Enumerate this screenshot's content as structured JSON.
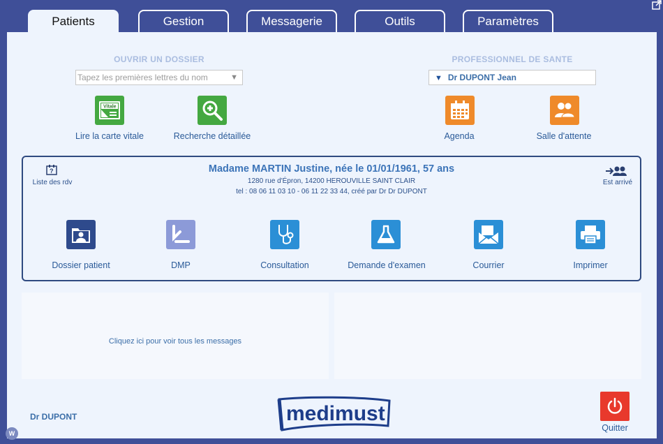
{
  "tabs": [
    {
      "label": "Patients",
      "active": true
    },
    {
      "label": "Gestion"
    },
    {
      "label": "Messagerie"
    },
    {
      "label": "Outils"
    },
    {
      "label": "Paramètres"
    }
  ],
  "open_file": {
    "title": "OUVRIR UN DOSSIER",
    "search_placeholder": "Tapez les premières lettres du nom",
    "actions": [
      {
        "label": "Lire la carte vitale",
        "icon": "vitale-card-icon",
        "badge": "Vitale"
      },
      {
        "label": "Recherche détaillée",
        "icon": "magnify-plus-icon"
      }
    ]
  },
  "professional": {
    "title": "PROFESSIONNEL DE SANTE",
    "selected": "Dr DUPONT Jean",
    "actions": [
      {
        "label": "Agenda",
        "icon": "calendar-icon"
      },
      {
        "label": "Salle d'attente",
        "icon": "waiting-room-icon"
      }
    ]
  },
  "patient": {
    "name": "Madame MARTIN Justine, née le 01/01/1961, 57 ans",
    "address": "1280 rue d'Épron, 14200 HEROUVILLE SAINT CLAIR",
    "tel": "tel : 08 06 11 03 10 - 06 11 22 33 44, créé par Dr Dr DUPONT",
    "rdv_list": "Liste des rdv",
    "arrived": "Est arrivé",
    "actions": [
      {
        "label": "Dossier patient",
        "icon": "patient-folder-icon"
      },
      {
        "label": "DMP",
        "icon": "dmp-icon"
      },
      {
        "label": "Consultation",
        "icon": "stethoscope-icon"
      },
      {
        "label": "Demande d'examen",
        "icon": "flask-icon"
      },
      {
        "label": "Courrier",
        "icon": "envelope-icon"
      },
      {
        "label": "Imprimer",
        "icon": "printer-icon"
      }
    ]
  },
  "messages": {
    "link": "Cliquez ici pour voir tous les messages"
  },
  "footer": {
    "user": "Dr DUPONT",
    "logo": "medimust",
    "quit": "Quitter",
    "badge": "W"
  },
  "colors": {
    "frame": "#3f4f98",
    "panel": "#eef4fd",
    "green": "#44a841",
    "orange": "#ef8a2a",
    "blue": "#2b8fd6",
    "quit": "#e8392c"
  }
}
